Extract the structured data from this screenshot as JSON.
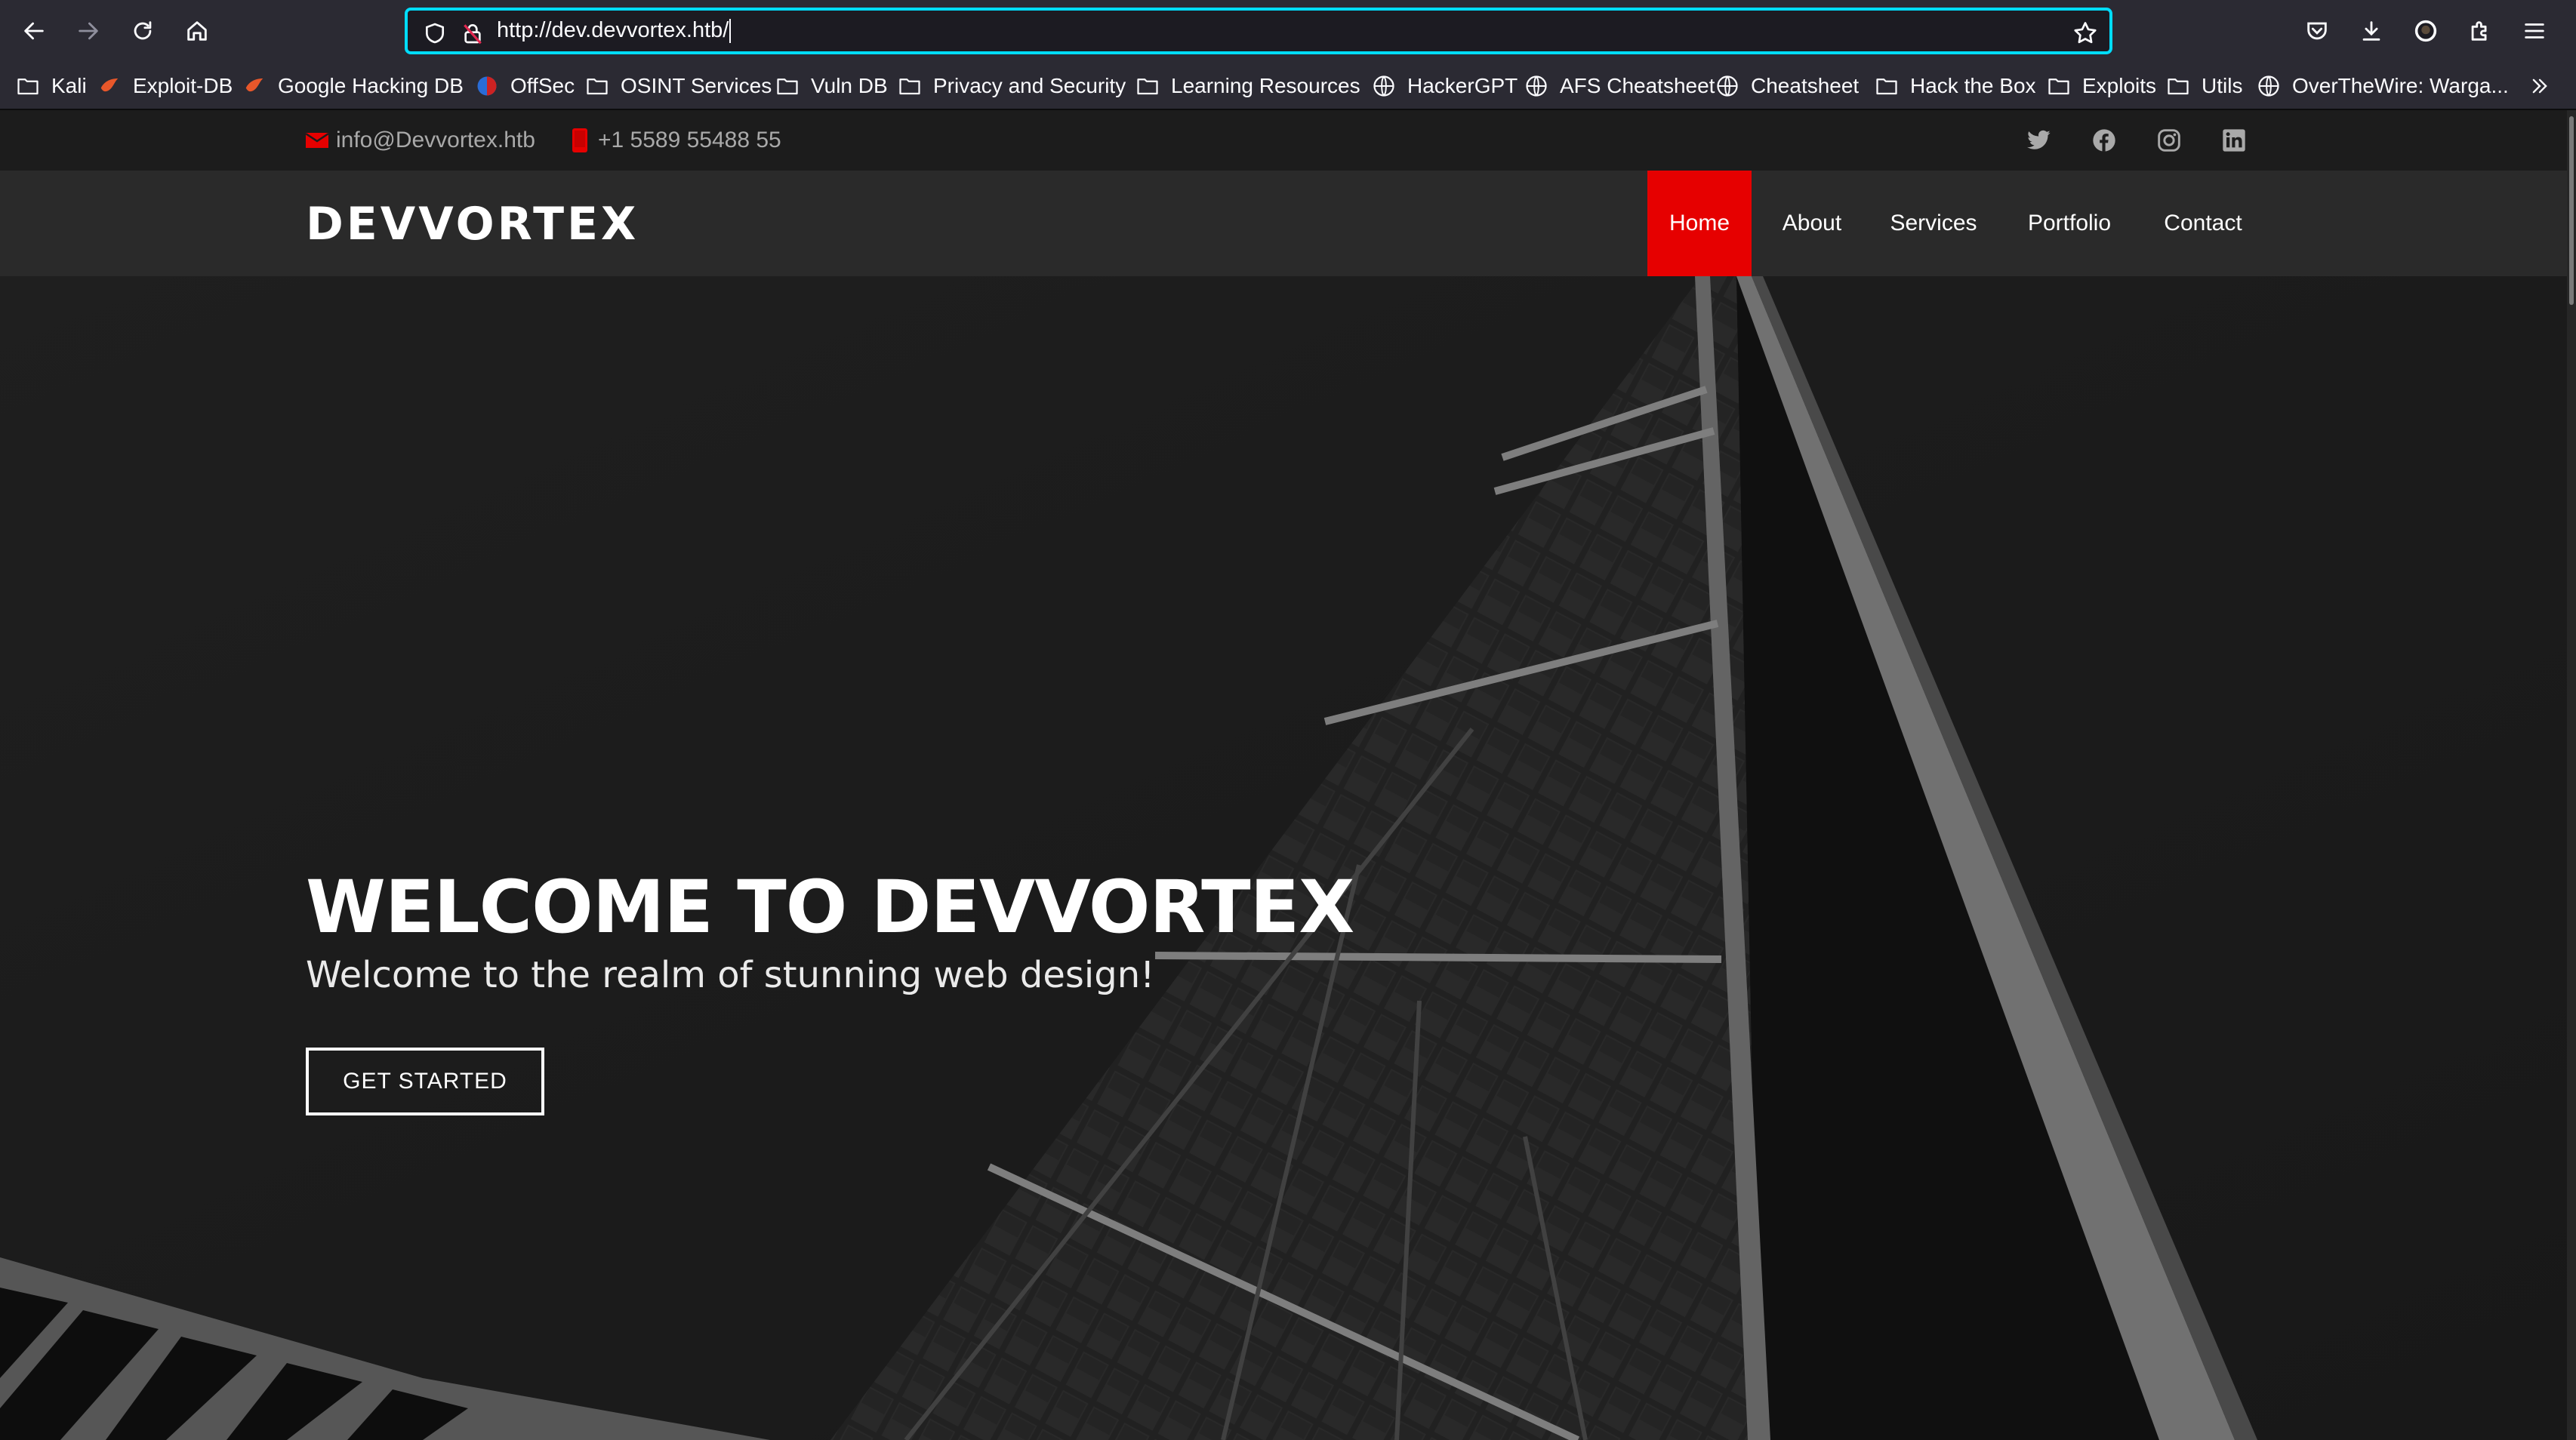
{
  "browser": {
    "url": "http://dev.devvortex.htb/",
    "bookmarks": [
      {
        "label": "Kali",
        "icon": "folder-icon"
      },
      {
        "label": "Exploit-DB",
        "icon": "exploit-db-icon"
      },
      {
        "label": "Google Hacking DB",
        "icon": "ghdb-icon"
      },
      {
        "label": "OffSec",
        "icon": "offsec-icon"
      },
      {
        "label": "OSINT Services",
        "icon": "folder-icon"
      },
      {
        "label": "Vuln DB",
        "icon": "folder-icon"
      },
      {
        "label": "Privacy and Security",
        "icon": "folder-icon"
      },
      {
        "label": "Learning Resources",
        "icon": "folder-icon"
      },
      {
        "label": "HackerGPT",
        "icon": "globe-icon"
      },
      {
        "label": "AFS Cheatsheet",
        "icon": "globe-icon"
      },
      {
        "label": "Cheatsheet",
        "icon": "globe-icon"
      },
      {
        "label": "Hack the Box",
        "icon": "folder-icon"
      },
      {
        "label": "Exploits",
        "icon": "folder-icon"
      },
      {
        "label": "Utils",
        "icon": "folder-icon"
      },
      {
        "label": "OverTheWire: Warga...",
        "icon": "globe-icon"
      }
    ]
  },
  "site": {
    "email": "info@Devvortex.htb",
    "phone": "+1 5589 55488 55",
    "logo": "DEVVORTEX",
    "nav": [
      "Home",
      "About",
      "Services",
      "Portfolio",
      "Contact"
    ],
    "hero": {
      "title": "WELCOME TO DEVVORTEX",
      "subtitle": "Welcome to the realm of stunning web design!",
      "cta": "GET STARTED"
    },
    "colors": {
      "accent": "#e60000"
    }
  }
}
